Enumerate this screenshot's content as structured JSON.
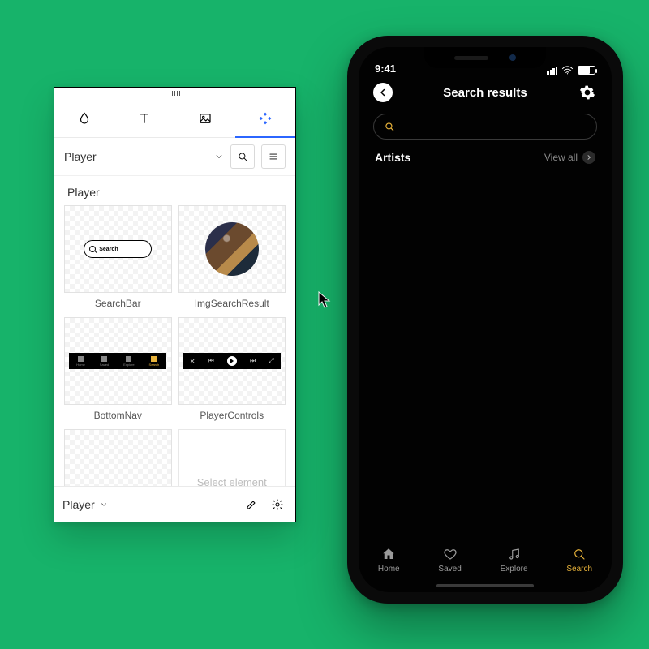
{
  "panel": {
    "tabs": [
      "fill",
      "text",
      "image",
      "component"
    ],
    "active_tab_index": 3,
    "dropdown": {
      "label": "Player"
    },
    "section_title": "Player",
    "components": [
      {
        "name": "SearchBar",
        "preview_label": "Search"
      },
      {
        "name": "ImgSearchResult"
      },
      {
        "name": "BottomNav",
        "items": [
          "Home",
          "Saved",
          "Explore",
          "Search"
        ],
        "active_index": 3
      },
      {
        "name": "PlayerControls"
      },
      {
        "name": ""
      },
      {
        "name": "",
        "placeholder": "Select element"
      }
    ],
    "footer_dropdown": "Player"
  },
  "phone": {
    "status": {
      "time": "9:41"
    },
    "header": {
      "title": "Search results"
    },
    "search": {
      "value": "",
      "placeholder": ""
    },
    "section": {
      "title": "Artists",
      "view_all": "View all"
    },
    "nav": {
      "items": [
        {
          "label": "Home",
          "icon": "home"
        },
        {
          "label": "Saved",
          "icon": "heart"
        },
        {
          "label": "Explore",
          "icon": "music"
        },
        {
          "label": "Search",
          "icon": "search"
        }
      ],
      "active_index": 3
    }
  },
  "colors": {
    "accent": "#e7b23a",
    "primary_blue": "#2b66ff",
    "bg": "#17b36a"
  }
}
